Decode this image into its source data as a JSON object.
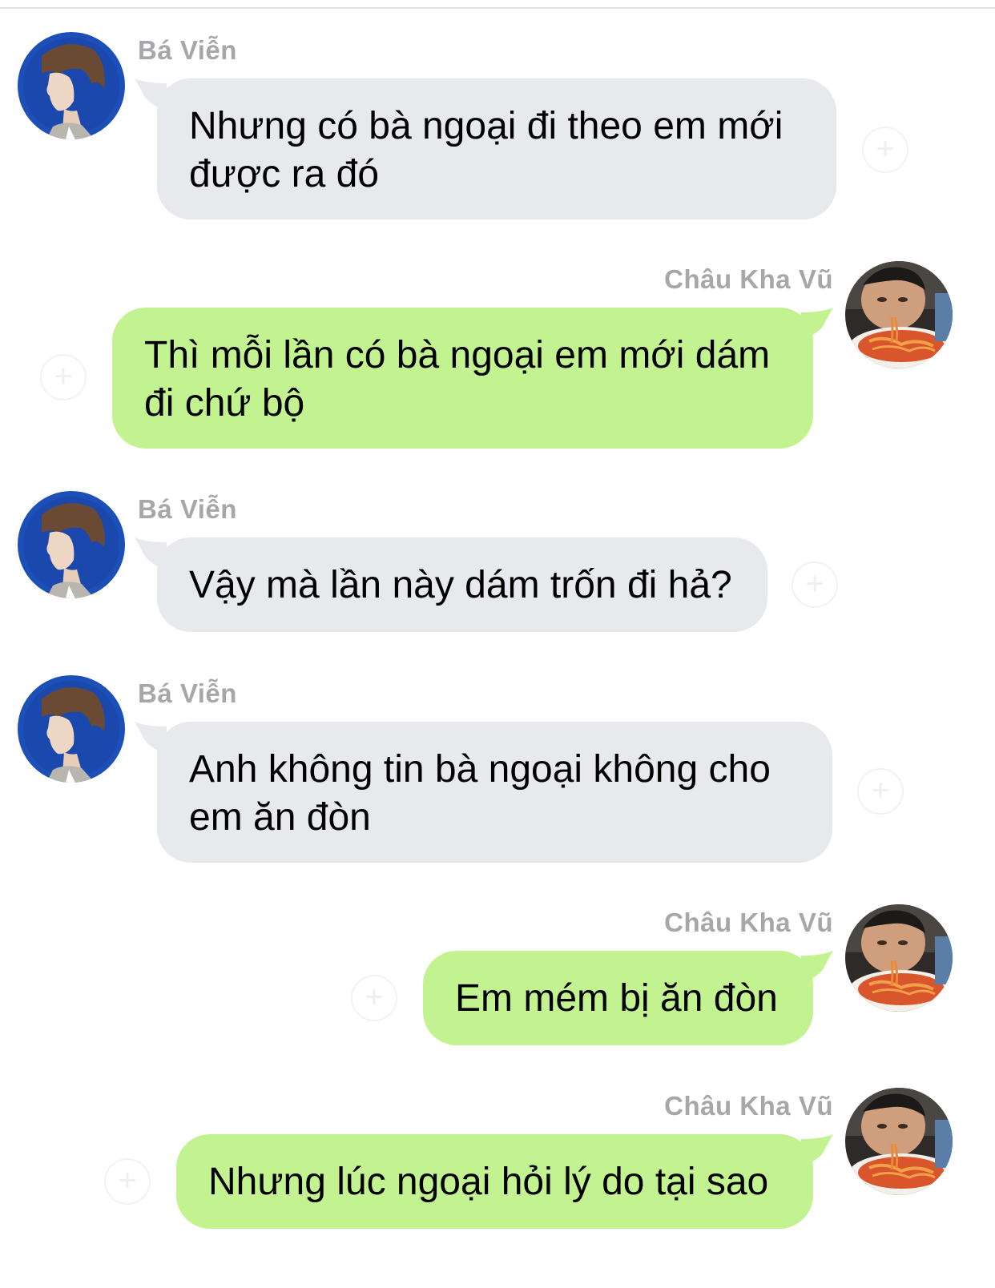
{
  "chat": {
    "messages": [
      {
        "sender": "Bá Viễn",
        "direction": "incoming",
        "lines": [
          "Nhưng có bà ngoại đi theo em mới",
          "được ra đó"
        ]
      },
      {
        "sender": "Châu Kha Vũ",
        "direction": "outgoing",
        "lines": [
          "Thì mỗi lần có bà ngoại em mới dám",
          "đi chứ bộ"
        ]
      },
      {
        "sender": "Bá Viễn",
        "direction": "incoming",
        "lines": [
          "Vậy mà lần này dám trốn đi hả?"
        ]
      },
      {
        "sender": "Bá Viễn",
        "direction": "incoming",
        "lines": [
          "Anh không tin bà ngoại không cho",
          "em ăn đòn"
        ]
      },
      {
        "sender": "Châu Kha Vũ",
        "direction": "outgoing",
        "lines": [
          "Em mém bị ăn đòn"
        ]
      },
      {
        "sender": "Châu Kha Vũ",
        "direction": "outgoing",
        "lines": [
          "Nhưng lúc ngoại hỏi lý do tại sao"
        ]
      }
    ]
  },
  "colors": {
    "incoming_bubble": "#e8e9ec",
    "outgoing_bubble": "#c3f290",
    "sender_name": "#a7a7ab",
    "background": "#ffffff"
  },
  "icons": {
    "reaction_add": "add-reaction-icon",
    "avatar_incoming": "avatar-ba-vien",
    "avatar_outgoing": "avatar-chau-kha-vu"
  }
}
